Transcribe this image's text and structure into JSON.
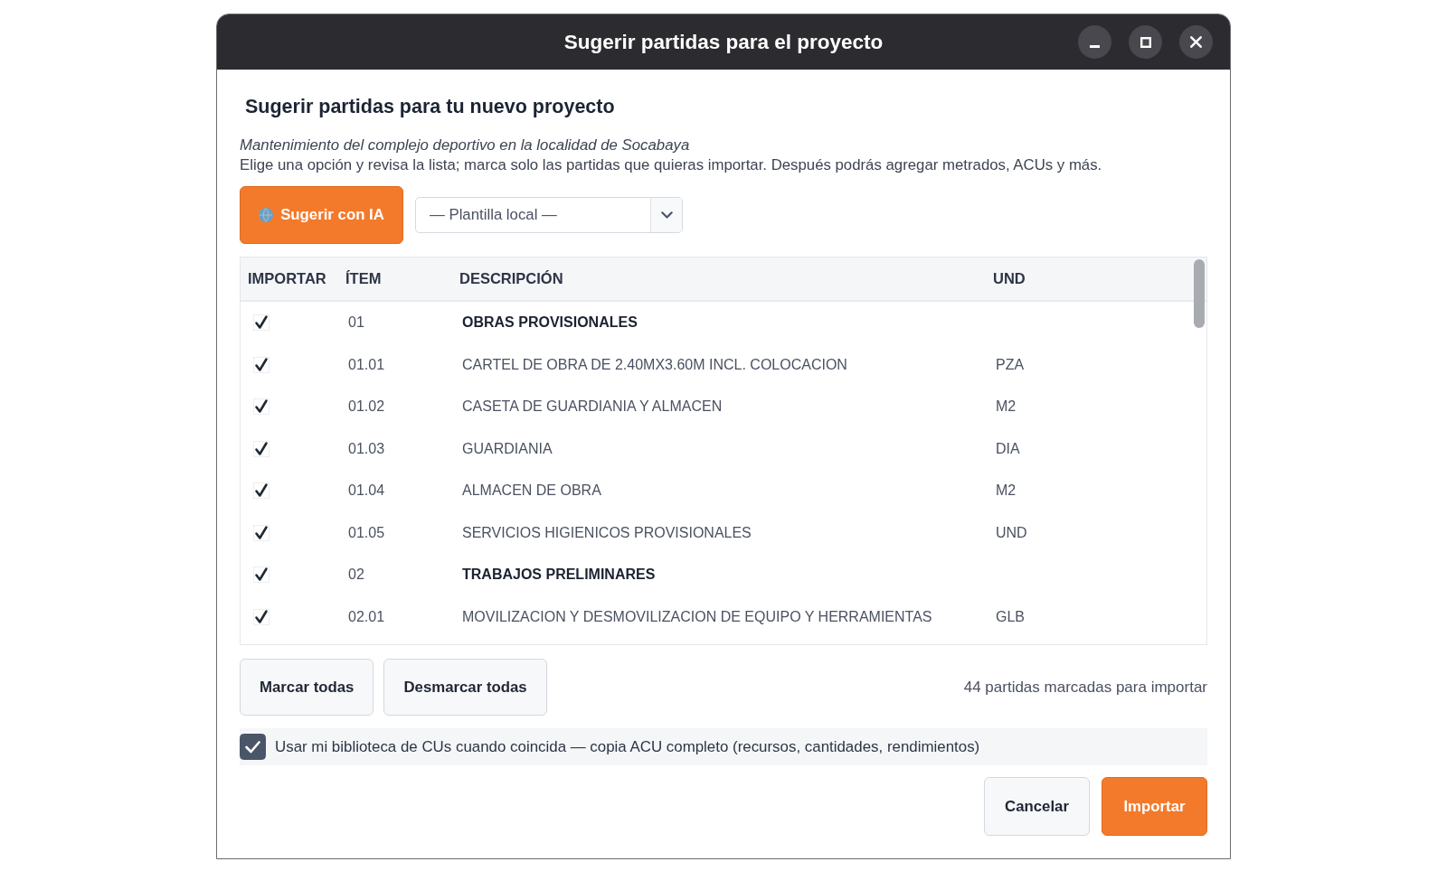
{
  "window": {
    "title": "Sugerir partidas para el proyecto"
  },
  "heading": "Sugerir partidas para tu nuevo proyecto",
  "project_name": "Mantenimiento del complejo deportivo en la localidad de Socabaya",
  "instructions": "Elige una opción y revisa la lista; marca solo las partidas que quieras importar. Después podrás agregar metrados, ACUs y más.",
  "suggest_button": {
    "label": "Sugerir con IA"
  },
  "template_select": {
    "value": "— Plantilla local —"
  },
  "table": {
    "columns": [
      "IMPORTAR",
      "ÍTEM",
      "DESCRIPCIÓN",
      "UND"
    ],
    "rows": [
      {
        "kind": "group",
        "checked": true,
        "item": "01",
        "description": "OBRAS PROVISIONALES"
      },
      {
        "kind": "item",
        "checked": true,
        "item": "01.01",
        "description": "CARTEL DE OBRA DE 2.40MX3.60M INCL. COLOCACION",
        "unit": "PZA"
      },
      {
        "kind": "item",
        "checked": true,
        "item": "01.02",
        "description": "CASETA DE GUARDIANIA Y ALMACEN",
        "unit": "M2"
      },
      {
        "kind": "item",
        "checked": true,
        "item": "01.03",
        "description": "GUARDIANIA",
        "unit": "DIA"
      },
      {
        "kind": "item",
        "checked": true,
        "item": "01.04",
        "description": "ALMACEN DE OBRA",
        "unit": "M2"
      },
      {
        "kind": "item",
        "checked": true,
        "item": "01.05",
        "description": "SERVICIOS HIGIENICOS PROVISIONALES",
        "unit": "UND"
      },
      {
        "kind": "group",
        "checked": true,
        "item": "02",
        "description": "TRABAJOS PRELIMINARES"
      },
      {
        "kind": "item",
        "checked": true,
        "item": "02.01",
        "description": "MOVILIZACION Y DESMOVILIZACION DE EQUIPO Y HERRAMIENTAS",
        "unit": "GLB"
      }
    ]
  },
  "bulk_buttons": [
    "Marcar todas",
    "Desmarcar todas"
  ],
  "selection_count": "44 partidas marcadas para importar",
  "library_option": {
    "label": "Usar mi biblioteca de CUs cuando coincida — copia ACU completo (recursos, cantidades, rendimientos)",
    "checked": true
  },
  "footer_buttons": [
    {
      "kind": "secondary",
      "label": "Cancelar"
    },
    {
      "kind": "primary",
      "label": "Importar"
    }
  ]
}
